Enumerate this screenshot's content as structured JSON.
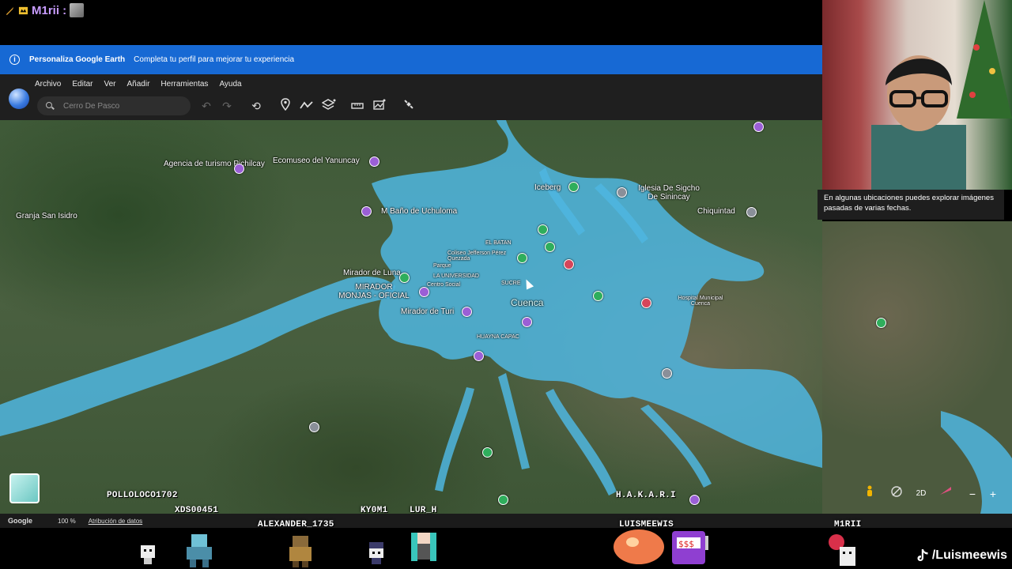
{
  "stream": {
    "chat_user": "M1rii :",
    "tiktok_handle": "/Luismeewis"
  },
  "banner": {
    "title": "Personaliza Google Earth",
    "text": "Completa tu perfil para mejorar tu experiencia"
  },
  "menu": [
    "Archivo",
    "Editar",
    "Ver",
    "Añadir",
    "Herramientas",
    "Ayuda"
  ],
  "search": {
    "placeholder": "Cerro De Pasco"
  },
  "map": {
    "city_label": "Cuenca",
    "labels": [
      "Agencia de turismo Pichilcay",
      "Ecomuseo del Yanuncay",
      "Granja San Isidro",
      "M Baño de Uchuloma",
      "Iceberg",
      "Iglesia De Sigcho De Sinincay",
      "Chiquintad",
      "EL BATAN",
      "Coliseo Jefferson Pérez Quezada",
      "Parque",
      "LA UNIVERSIDAD",
      "SUCRE",
      "Centro Social",
      "Mirador de Turi",
      "MIRADOR MONJAS - OFICIAL",
      "Mirador de Luna",
      "HUAYNA CAPAC",
      "Hospital Municipal Cuenca"
    ]
  },
  "webcam_tooltip": "En algunas ubicaciones puedes explorar imágenes pasadas de varias fechas.",
  "bottom_bar": {
    "google": "Google",
    "zoom": "100 %",
    "attribution": "Atribución de datos"
  },
  "controls": {
    "mode_2d": "2D",
    "zoom_out": "−",
    "zoom_in": "+"
  },
  "chatters": [
    "POLLOLOCO1702",
    "XDS00451",
    "ALEXANDER_1735",
    "KY0M1",
    "LUR_H",
    "H.A.K.A.R.I",
    "LUISMEEWIS",
    "M1RII"
  ]
}
